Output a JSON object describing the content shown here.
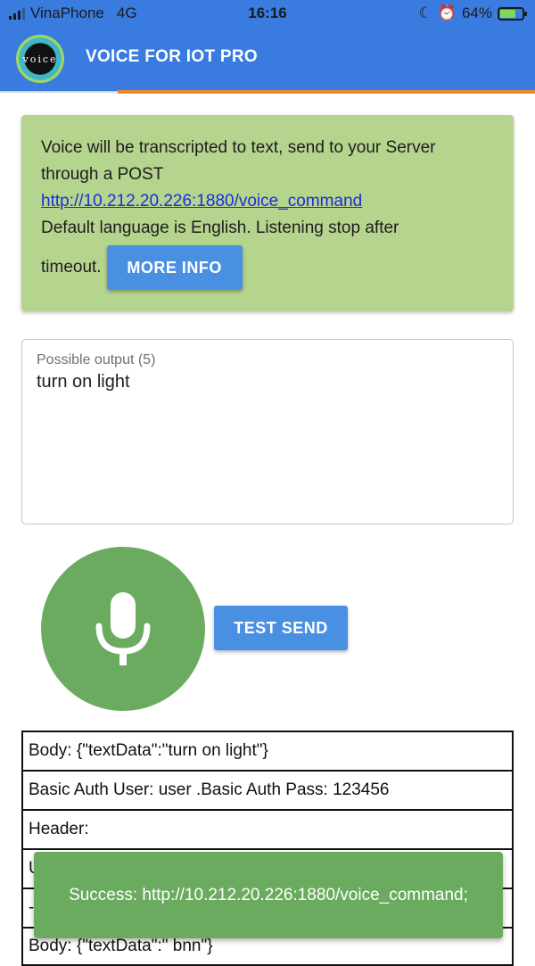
{
  "status_bar": {
    "carrier": "VinaPhone",
    "network": "4G",
    "time": "16:16",
    "battery": "64%",
    "battery_level": 0.64
  },
  "app_bar": {
    "logo_text": "voice",
    "title": "VOICE FOR IOT PRO"
  },
  "info": {
    "line1": "Voice will be transcripted to text, send to your Server through a POST",
    "url": "http://10.212.20.226:1880/voice_command",
    "line2": "Default language is English. Listening stop after",
    "line3": "timeout.",
    "more_button": "MORE INFO"
  },
  "output": {
    "label": "Possible output (5)",
    "value": "turn on light"
  },
  "actions": {
    "test_send_button": "TEST SEND"
  },
  "log_rows": [
    "Body: {\"textData\":\"turn on light\"}",
    "Basic Auth User: user .Basic Auth Pass: 123456",
    "Header:",
    "U",
    "-",
    "Body: {\"textData\":\" bnn\"}"
  ],
  "toast": {
    "message": "Success: http://10.212.20.226:1880/voice_command;"
  },
  "colors": {
    "app_bar": "#3a7be0",
    "accent": "#e8893a",
    "info_card": "#b5d48e",
    "button": "#4a90e2",
    "mic": "#6aab5f",
    "toast": "#6aab5f"
  }
}
